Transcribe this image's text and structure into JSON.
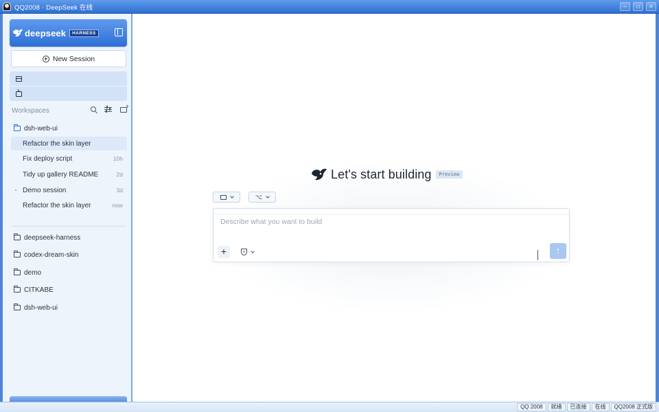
{
  "window": {
    "title": "QQ2008 · DeepSeek 在线",
    "controls": [
      "–",
      "□",
      "×"
    ]
  },
  "sidebar": {
    "brand_name": "deepseek",
    "brand_tag": "HARNESS",
    "new_session_label": "New Session",
    "nav_icons": [
      "layout-icon",
      "terminal-icon"
    ],
    "workspaces_title": "Workspaces",
    "active_workspace": "dsh-web-ui",
    "sessions": [
      {
        "label": "Refactor the skin layer",
        "time": ""
      },
      {
        "label": "Fix deploy script",
        "time": "10h"
      },
      {
        "label": "Tidy up gallery README",
        "time": "2d"
      },
      {
        "label": "Demo session",
        "time": "3d"
      },
      {
        "label": "Refactor the skin layer",
        "time": "now"
      }
    ],
    "folders": [
      "deepseek-harness",
      "codex-dream-skin",
      "demo",
      "CITKABE",
      "dsh-web-ui"
    ]
  },
  "main": {
    "heading": "Let's start building",
    "badge": "Preview",
    "composer_placeholder": "Describe what you want to build",
    "add_symbol": "+",
    "send_symbol": "↑",
    "branch_symbol": "⌥"
  },
  "statusbar": {
    "cells": [
      "QQ 2008",
      "就绪",
      "已连接",
      "在线",
      "QQ2008 正式版"
    ]
  },
  "colors": {
    "brand_blue": "#2f6fd1",
    "sidebar_bg": "#eef4fc",
    "send_button": "#a8c7f1"
  }
}
